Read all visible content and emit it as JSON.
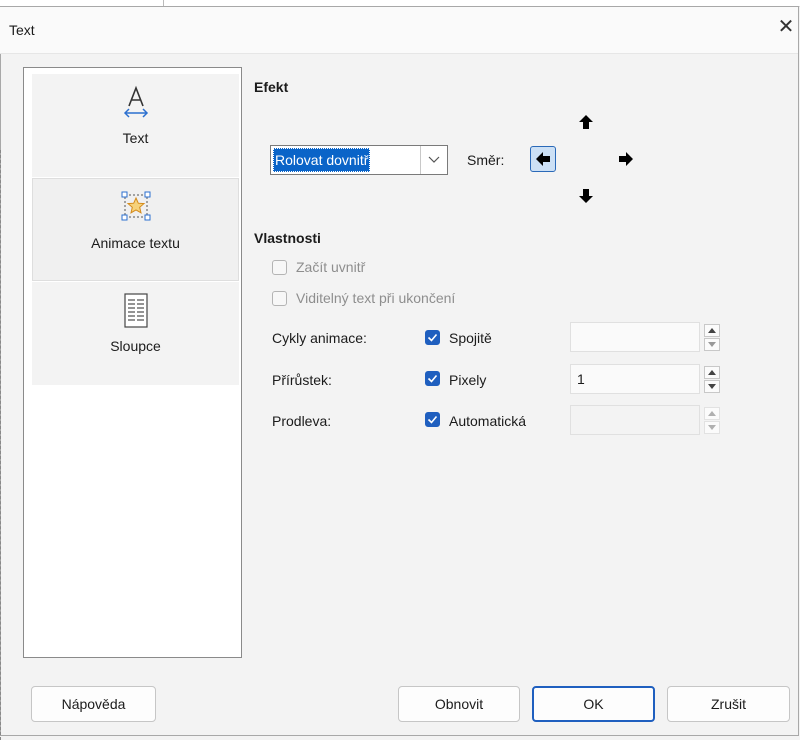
{
  "window": {
    "title": "Text"
  },
  "nav": {
    "items": [
      {
        "label": "Text",
        "icon": "text-icon"
      },
      {
        "label": "Animace textu",
        "icon": "animated-star-icon"
      },
      {
        "label": "Sloupce",
        "icon": "columns-icon"
      }
    ],
    "selected": "Animace textu"
  },
  "effect": {
    "heading": "Efekt",
    "selected_effect": "Rolovat dovnitř",
    "direction_label": "Směr:",
    "direction_selected": "left"
  },
  "properties": {
    "heading": "Vlastnosti",
    "start_inside": {
      "label": "Začít uvnitř",
      "checked": false,
      "enabled": false
    },
    "visible_on_exit": {
      "label": "Viditelný text při ukončení",
      "checked": false,
      "enabled": false
    },
    "rows": [
      {
        "label": "Cykly animace:",
        "check_label": "Spojitě",
        "checked": true,
        "value": ""
      },
      {
        "label": "Přírůstek:",
        "check_label": "Pixely",
        "checked": true,
        "value": "1"
      },
      {
        "label": "Prodleva:",
        "check_label": "Automatická",
        "checked": true,
        "value": ""
      }
    ]
  },
  "buttons": {
    "help": "Nápověda",
    "reset": "Obnovit",
    "ok": "OK",
    "cancel": "Zrušit"
  },
  "colors": {
    "accent": "#1f5fbf",
    "selection": "#0a64c8"
  }
}
